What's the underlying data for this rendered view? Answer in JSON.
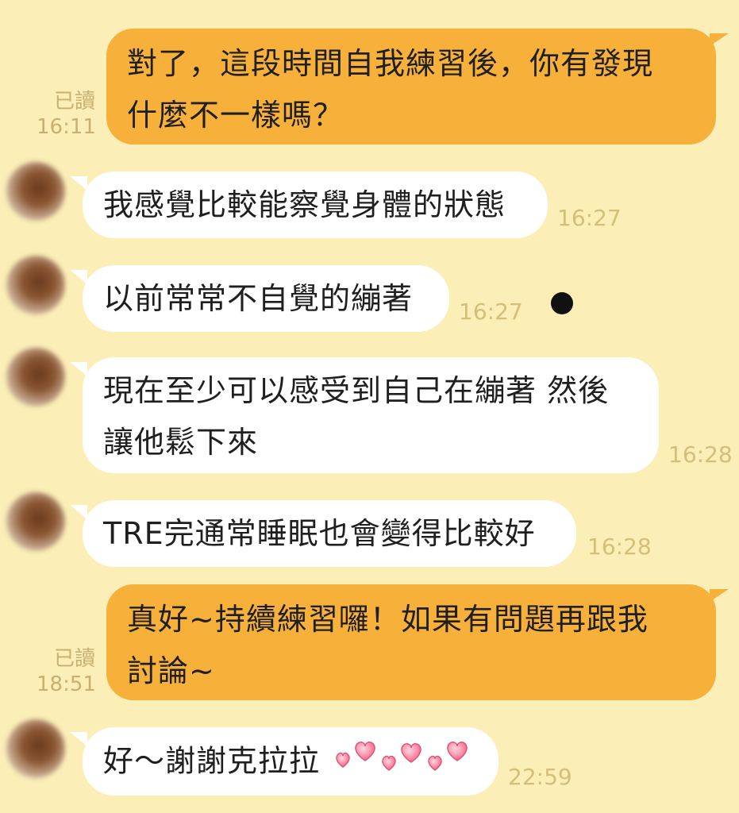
{
  "messages": [
    {
      "id": "m1",
      "direction": "outgoing",
      "lines": [
        "對了，這段時間自我練習後，你有發現",
        "什麼不一樣嗎？"
      ],
      "read": "已讀",
      "time": "16:11"
    },
    {
      "id": "m2",
      "direction": "incoming",
      "lines": [
        "我感覺比較能察覺身體的狀態"
      ],
      "time": "16:27"
    },
    {
      "id": "m3",
      "direction": "incoming",
      "lines": [
        "以前常常不自覺的繃著"
      ],
      "time": "16:27"
    },
    {
      "id": "m4",
      "direction": "incoming",
      "lines": [
        "現在至少可以感受到自己在繃著 然後",
        "讓他鬆下來"
      ],
      "time": "16:28"
    },
    {
      "id": "m5",
      "direction": "incoming",
      "lines": [
        "TRE完通常睡眠也會變得比較好"
      ],
      "time": "16:28"
    },
    {
      "id": "m6",
      "direction": "outgoing",
      "lines": [
        "真好~持續練習囉！如果有問題再跟我",
        "討論~"
      ],
      "read": "已讀",
      "time": "18:51"
    },
    {
      "id": "m7",
      "direction": "incoming",
      "lines": [
        "好～謝謝克拉拉"
      ],
      "emoji": "hearts",
      "time": "22:59"
    }
  ],
  "colors": {
    "background": "#FBEEB7",
    "outgoing_bubble": "#F7B13A",
    "incoming_bubble": "#FFFFFF",
    "meta_text": "#C9B070"
  },
  "icons": [
    "avatar-blurred",
    "heart-emoji"
  ]
}
